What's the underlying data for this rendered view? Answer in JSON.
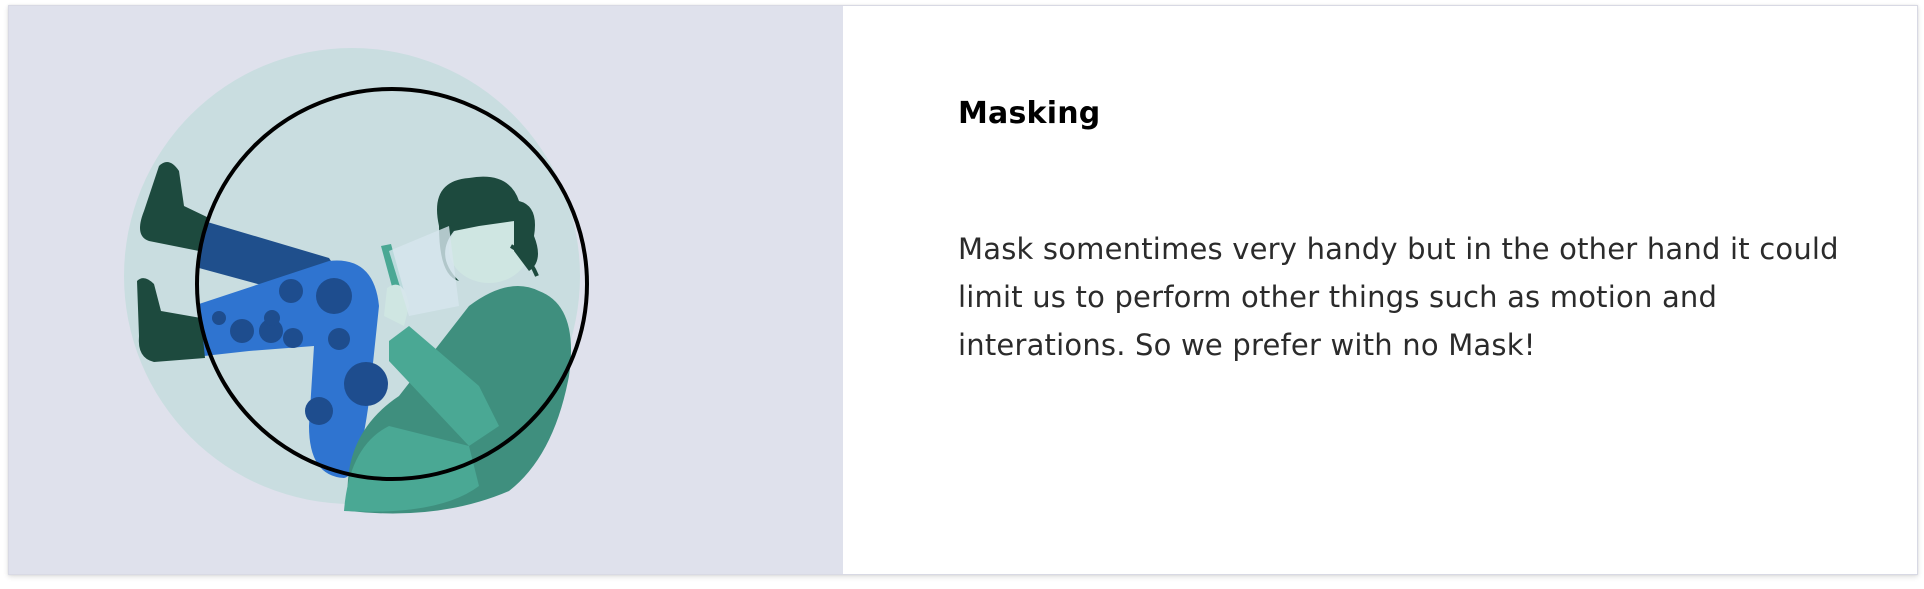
{
  "card": {
    "title": "Masking",
    "description": "Mask somentimes very handy but in the other hand it could limit us to perform other things such as motion and interations. So we prefer with no Mask!"
  },
  "illustration": {
    "subject": "person sitting curled up inside a bubble looking at a phone",
    "icon": "person-in-bubble-illustration"
  },
  "colors": {
    "panel_background": "#dfe1ec",
    "bubble": "#c9dde0",
    "mask_circle_stroke": "#000000",
    "hair_dark": "#1d4a3e",
    "skin": "#cfe6e2",
    "sweater": "#3f8f7e",
    "sweater_light": "#4aa894",
    "jeans_dark": "#1f4f8c",
    "pants_blue": "#2f74d0",
    "pants_dots": "#1e4d8e",
    "phone": "#4aa894"
  }
}
